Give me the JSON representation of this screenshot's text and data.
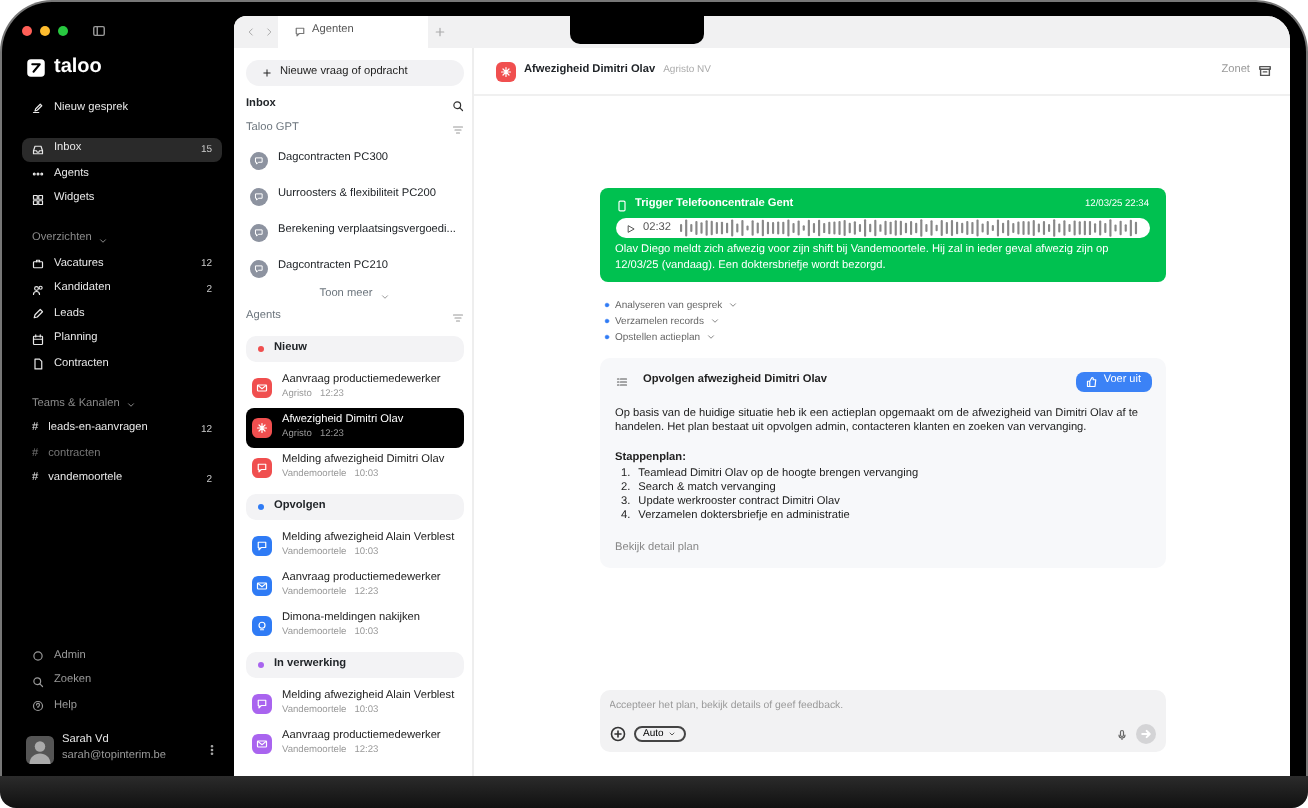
{
  "sidebar": {
    "brand": "taloo",
    "new_chat": "Nieuw gesprek",
    "items": [
      {
        "label": "Inbox",
        "count": "15",
        "selected": true
      },
      {
        "label": "Agents",
        "selected": false
      },
      {
        "label": "Widgets",
        "selected": false
      }
    ],
    "sections": [
      {
        "title": "Overzichten",
        "items": [
          {
            "label": "Vacatures",
            "count": "12",
            "selected": false
          },
          {
            "label": "Kandidaten",
            "count": "2",
            "selected": false
          },
          {
            "label": "Leads",
            "selected": false
          },
          {
            "label": "Planning",
            "selected": false
          },
          {
            "label": "Contracten",
            "selected": false
          }
        ]
      },
      {
        "title": "Teams & Kanalen",
        "items": [
          {
            "prefix": "#",
            "label": "leads-en-aanvragen",
            "count": "12",
            "muted": false,
            "selected": false
          },
          {
            "prefix": "#",
            "label": "contracten",
            "muted": true,
            "selected": false
          },
          {
            "prefix": "#",
            "label": "vandemoortele",
            "count": "2",
            "muted": false,
            "selected": false
          }
        ]
      }
    ],
    "footer": [
      {
        "label": "Admin"
      },
      {
        "label": "Zoeken"
      },
      {
        "label": "Help"
      }
    ],
    "user": {
      "name": "Sarah Vd",
      "email": "sarah@topinterim.be"
    }
  },
  "tab_bar": {
    "tab": "Agenten"
  },
  "list": {
    "new_request": "Nieuwe vraag of opdracht",
    "title": "Inbox",
    "gpt": {
      "title": "Taloo GPT",
      "items": [
        {
          "label": "Dagcontracten PC300"
        },
        {
          "label": "Uurroosters & flexibiliteit PC200"
        },
        {
          "label": "Berekening verplaatsingsvergoedi..."
        },
        {
          "label": "Dagcontracten PC210"
        }
      ],
      "more": "Toon meer"
    },
    "agents": {
      "title": "Agents",
      "groups": [
        {
          "title": "Nieuw",
          "color": "#f04f4f",
          "items": [
            {
              "kind": "mail",
              "title": "Aanvraag productiemedewerker",
              "company": "Agristo",
              "time": "12:23",
              "selected": false
            },
            {
              "kind": "spark",
              "title": "Afwezigheid Dimitri Olav",
              "company": "Agristo",
              "time": "12:23",
              "selected": true
            },
            {
              "kind": "chat",
              "title": "Melding afwezigheid Dimitri Olav",
              "company": "Vandemoortele",
              "time": "10:03",
              "selected": false
            }
          ]
        },
        {
          "title": "Opvolgen",
          "color": "#2f7bf5",
          "items": [
            {
              "kind": "chat",
              "title": "Melding afwezigheid Alain Verblest",
              "company": "Vandemoortele",
              "time": "10:03",
              "selected": false
            },
            {
              "kind": "mail",
              "title": "Aanvraag productiemedewerker",
              "company": "Vandemoortele",
              "time": "12:23",
              "selected": false
            },
            {
              "kind": "bulb",
              "title": "Dimona-meldingen nakijken",
              "company": "Vandemoortele",
              "time": "10:03",
              "selected": false
            }
          ]
        },
        {
          "title": "In verwerking",
          "color": "#a964ef",
          "items": [
            {
              "kind": "chat",
              "title": "Melding afwezigheid Alain Verblest",
              "company": "Vandemoortele",
              "time": "10:03",
              "selected": false
            },
            {
              "kind": "mail",
              "title": "Aanvraag productiemedewerker",
              "company": "Vandemoortele",
              "time": "12:23",
              "selected": false
            }
          ]
        }
      ]
    }
  },
  "conversation": {
    "title": "Afwezigheid Dimitri Olav",
    "company": "Agristo NV",
    "time": "Zonet",
    "trigger": {
      "title": "Trigger Telefooncentrale Gent",
      "time": "12/03/25 22:34",
      "duration": "02:32",
      "text": "Olav Diego meldt zich afwezig voor zijn shift bij Vandemoortele. Hij zal in ieder geval afwezig zijn op 12/03/25 (vandaag). Een doktersbriefje wordt bezorgd."
    },
    "steps": [
      {
        "label": "Analyseren van gesprek"
      },
      {
        "label": "Verzamelen records"
      },
      {
        "label": "Opstellen actieplan"
      }
    ],
    "plan": {
      "title": "Opvolgen afwezigheid Dimitri Olav",
      "action": "Voer uit",
      "intro": "Op basis van de huidige situatie heb ik een actieplan opgemaakt om de afwezigheid van Dimitri Olav af te handelen. Het plan bestaat uit opvolgen admin, contacteren klanten en zoeken van vervanging.",
      "steps_title": "Stappenplan:",
      "steps": [
        {
          "number": "1.",
          "text": "Teamlead Dimitri Olav op de hoogte brengen vervanging"
        },
        {
          "number": "2.",
          "text": "Search & match vervanging"
        },
        {
          "number": "3.",
          "text": "Update werkrooster contract Dimitri Olav"
        },
        {
          "number": "4.",
          "text": "Verzamelen doktersbriefje en administratie"
        }
      ],
      "link": "Bekijk detail plan"
    },
    "composer": {
      "placeholder": "Accepteer het plan, bekijk details of geef feedback.",
      "mode": "Auto"
    }
  }
}
